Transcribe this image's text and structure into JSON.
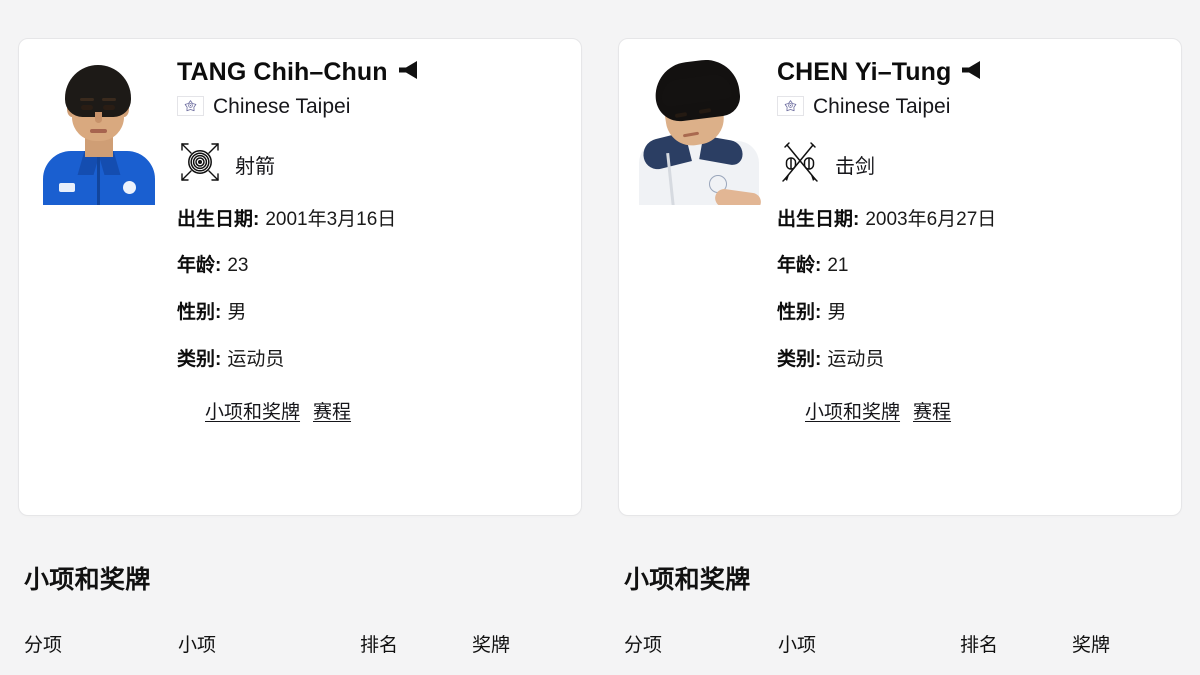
{
  "theme": {
    "page_bg": "#f4f4f5",
    "card_bg": "#ffffff",
    "card_border": "#e6e6e8",
    "text": "#111111",
    "link": "#16161a"
  },
  "cards": [
    {
      "portrait_alt": "TANG Chih-Chun portrait",
      "name": "TANG Chih–Chun",
      "audio_icon": "speaker-icon",
      "flag_icon": "chinese-taipei-flag-icon",
      "noc": "Chinese Taipei",
      "sport_icon": "archery-icon",
      "sport": "射箭",
      "details": [
        {
          "label": "出生日期:",
          "value": "2001年3月16日"
        },
        {
          "label": "年龄:",
          "value": "23"
        },
        {
          "label": "性别:",
          "value": "男"
        },
        {
          "label": "类别:",
          "value": "运动员"
        }
      ],
      "links": [
        {
          "label": "小项和奖牌"
        },
        {
          "label": "赛程"
        }
      ]
    },
    {
      "portrait_alt": "CHEN Yi-Tung portrait",
      "name": "CHEN Yi–Tung",
      "audio_icon": "speaker-icon",
      "flag_icon": "chinese-taipei-flag-icon",
      "noc": "Chinese Taipei",
      "sport_icon": "fencing-icon",
      "sport": "击剑",
      "details": [
        {
          "label": "出生日期:",
          "value": "2003年6月27日"
        },
        {
          "label": "年龄:",
          "value": "21"
        },
        {
          "label": "性别:",
          "value": "男"
        },
        {
          "label": "类别:",
          "value": "运动员"
        }
      ],
      "links": [
        {
          "label": "小项和奖牌"
        },
        {
          "label": "赛程"
        }
      ]
    }
  ],
  "sections": [
    {
      "title": "小项和奖牌",
      "columns": [
        "分项",
        "小项",
        "排名",
        "奖牌"
      ],
      "rows": []
    },
    {
      "title": "小项和奖牌",
      "columns": [
        "分项",
        "小项",
        "排名",
        "奖牌"
      ],
      "rows": []
    }
  ]
}
